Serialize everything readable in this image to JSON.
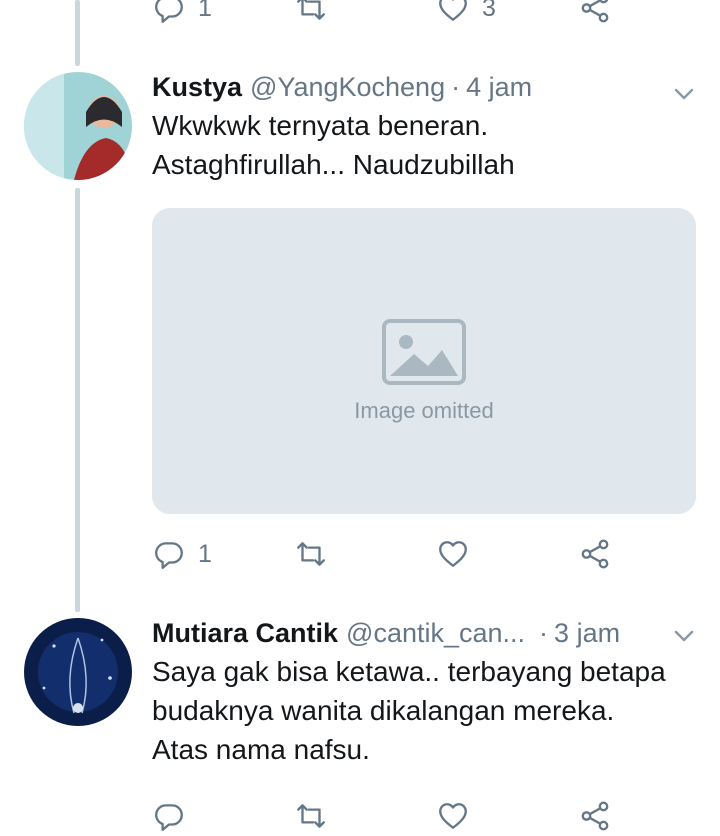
{
  "top_actions": {
    "reply_count": "1",
    "like_count": "3"
  },
  "tweets": [
    {
      "name": "Kustya",
      "handle": "@YangKocheng",
      "separator": "·",
      "time": "4 jam",
      "text_lines": [
        "Wkwkwk ternyata beneran.",
        "Astaghfirullah... Naudzubillah"
      ],
      "media_note": "Image omitted",
      "reply_count": "1"
    },
    {
      "name": "Mutiara Cantik",
      "handle": "@cantik_can...",
      "separator": "·",
      "time": "3 jam",
      "text_lines": [
        "Saya gak bisa ketawa.. terbayang betapa",
        "budaknya wanita dikalangan mereka.",
        "Atas nama nafsu."
      ]
    }
  ],
  "icons": {
    "reply": "reply-icon",
    "retweet": "retweet-icon",
    "like": "heart-icon",
    "share": "share-icon",
    "caret": "chevron-down-icon"
  },
  "colors": {
    "icon_gray": "#657786",
    "thread_line": "#ccd6dd",
    "text": "#14171a"
  }
}
